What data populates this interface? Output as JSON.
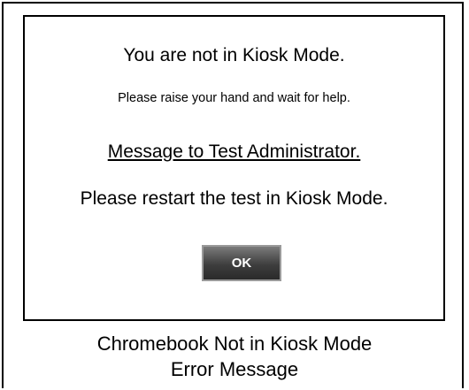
{
  "dialog": {
    "title": "You are not in Kiosk Mode.",
    "subtitle": "Please raise your hand and wait for help.",
    "admin_heading": "Message to Test Administrator.",
    "admin_message": "Please restart the test in Kiosk Mode.",
    "ok_label": "OK"
  },
  "caption": {
    "line1": "Chromebook Not in Kiosk Mode",
    "line2": "Error Message"
  }
}
